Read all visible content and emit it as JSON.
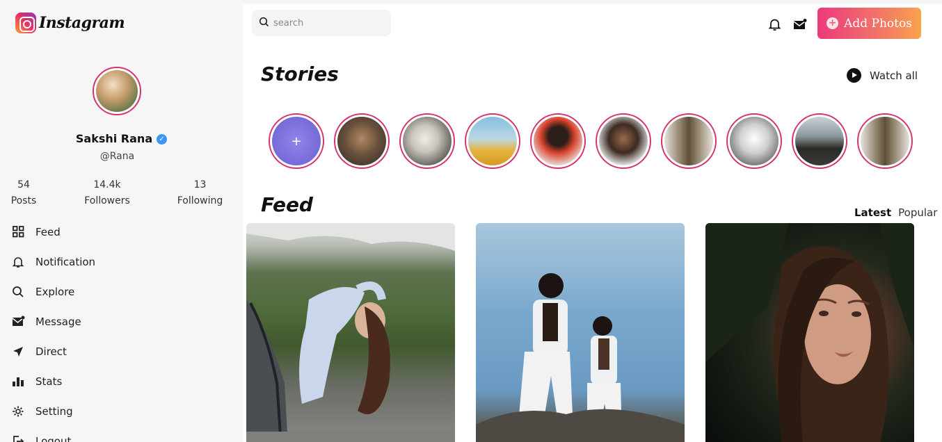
{
  "app": {
    "name": "Instagram"
  },
  "profile": {
    "name": "Sakshi Rana",
    "handle": "@Rana"
  },
  "stats": [
    {
      "value": "54",
      "label": "Posts"
    },
    {
      "value": "14.4k",
      "label": "Followers"
    },
    {
      "value": "13",
      "label": "Following"
    }
  ],
  "menu": [
    {
      "label": "Feed",
      "icon": "grid-icon"
    },
    {
      "label": "Notification",
      "icon": "bell-icon"
    },
    {
      "label": "Explore",
      "icon": "search-icon"
    },
    {
      "label": "Message",
      "icon": "mail-icon"
    },
    {
      "label": "Direct",
      "icon": "send-icon"
    },
    {
      "label": "Stats",
      "icon": "bar-chart-icon"
    },
    {
      "label": "Setting",
      "icon": "gear-icon"
    },
    {
      "label": "Logout",
      "icon": "logout-icon"
    }
  ],
  "search": {
    "placeholder": "search"
  },
  "header": {
    "add_button": "Add Photos"
  },
  "stories": {
    "title": "Stories",
    "watch_all": "Watch all",
    "add_symbol": "+"
  },
  "feed": {
    "title": "Feed",
    "tabs": {
      "latest": "Latest",
      "popular": "Popular"
    }
  },
  "colors": {
    "accent": "#d6336c",
    "button_gradient_start": "#ec3a7a",
    "button_gradient_end": "#f9a44d",
    "verified": "#3b97f1"
  }
}
